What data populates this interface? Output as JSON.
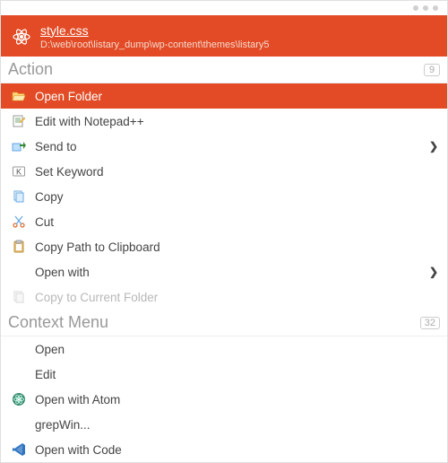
{
  "header": {
    "file_name": "style.css",
    "file_path": "D:\\web\\root\\listary_dump\\wp-content\\themes\\listary5"
  },
  "sections": {
    "action": {
      "label": "Action",
      "count": "9"
    },
    "context": {
      "label": "Context Menu",
      "count": "32"
    }
  },
  "action_items": {
    "open_folder": "Open Folder",
    "edit_notepad": "Edit with Notepad++",
    "send_to": "Send to",
    "set_keyword": "Set Keyword",
    "copy": "Copy",
    "cut": "Cut",
    "copy_path": "Copy Path to Clipboard",
    "open_with": "Open with",
    "copy_current": "Copy to Current Folder"
  },
  "context_items": {
    "open": "Open",
    "edit": "Edit",
    "open_atom": "Open with Atom",
    "grepwin": "grepWin...",
    "open_code": "Open with Code"
  }
}
